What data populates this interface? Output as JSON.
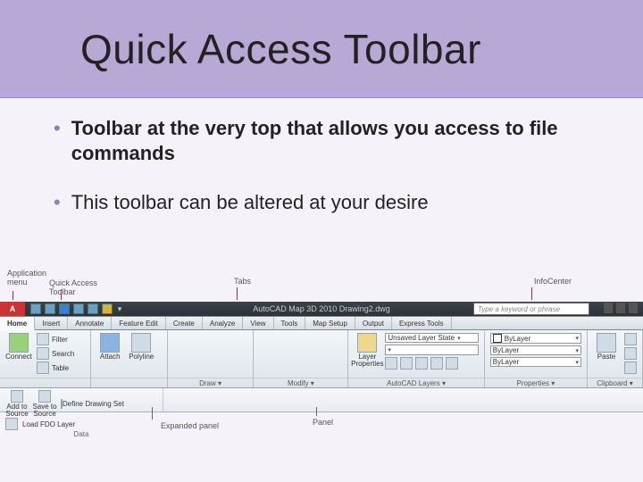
{
  "title": "Quick Access Toolbar",
  "bullets": {
    "b1": "Toolbar at the very top that allows you access to file commands",
    "b2": "This toolbar can be altered at your desire"
  },
  "labels": {
    "app_menu": "Application\nmenu",
    "qat": "Quick Access\nToolbar",
    "tabs": "Tabs",
    "infocenter": "InfoCenter",
    "panel": "Panel",
    "expanded": "Expanded panel"
  },
  "titlebar": {
    "app_letter": "A",
    "title": "AutoCAD Map 3D 2010    Drawing2.dwg",
    "search_placeholder": "Type a keyword or phrase"
  },
  "tabs": {
    "t0": "Home",
    "t1": "Insert",
    "t2": "Annotate",
    "t3": "Feature Edit",
    "t4": "Create",
    "t5": "Analyze",
    "t6": "View",
    "t7": "Tools",
    "t8": "Map Setup",
    "t9": "Output",
    "t10": "Express Tools"
  },
  "panels": {
    "p_data_a": {
      "big0": "Connect",
      "s0": "Filter",
      "s1": "Search",
      "s2": "Table"
    },
    "p_data_b": {
      "big0": "Attach",
      "big1": "Polyline"
    },
    "p_draw": {
      "title": "Draw ▾"
    },
    "p_modify": {
      "title": "Modify ▾"
    },
    "p_layers": {
      "title": "AutoCAD Layers ▾",
      "big0": "Layer\nProperties",
      "drop": "Unsaved Layer State"
    },
    "p_props": {
      "title": "Properties ▾",
      "r0": "ByLayer",
      "r1": "ByLayer",
      "r2": "ByLayer"
    },
    "p_clip": {
      "title": "Clipboard ▾",
      "big0": "Paste"
    }
  },
  "bottom": {
    "b0_a": "Add to\nSource",
    "b0_b": "Save to\nSource",
    "b0_c": "Define Drawing Set",
    "b0_d": "Load FDO Layer",
    "b0_title": "Data"
  }
}
